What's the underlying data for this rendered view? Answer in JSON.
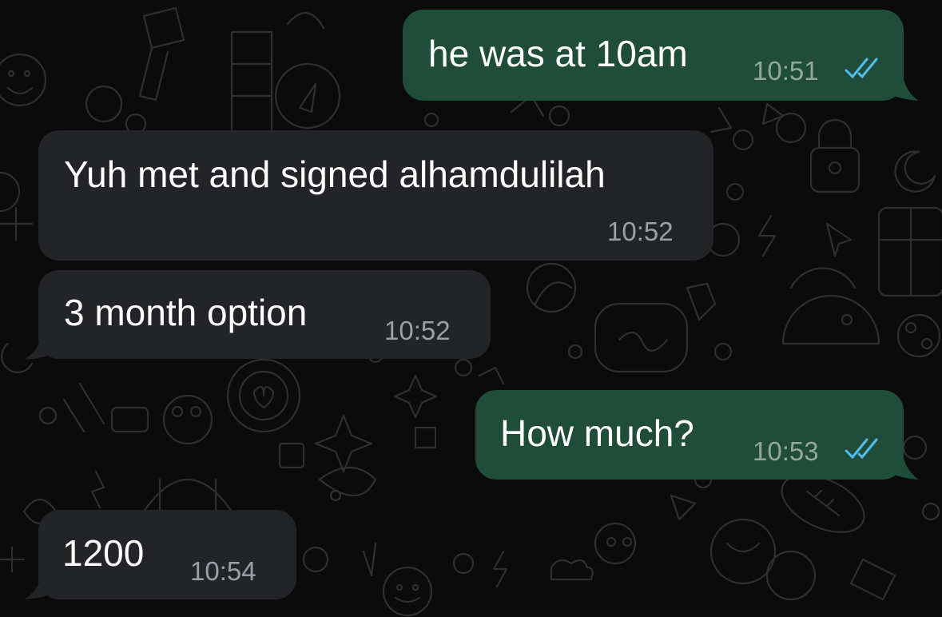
{
  "theme": {
    "outgoing_bubble": "#1f4d3a",
    "incoming_bubble": "#222428",
    "background": "#0b0b0b",
    "read_ticks": "#53bdeb"
  },
  "messages": [
    {
      "direction": "outgoing",
      "text": "he was at 10am",
      "time": "10:51",
      "status": "read"
    },
    {
      "direction": "incoming",
      "text": "Yuh met and signed alhamdulilah",
      "time": "10:52"
    },
    {
      "direction": "incoming",
      "text": "3 month option",
      "time": "10:52"
    },
    {
      "direction": "outgoing",
      "text": "How much?",
      "time": "10:53",
      "status": "read"
    },
    {
      "direction": "incoming",
      "text": "1200",
      "time": "10:54"
    }
  ]
}
